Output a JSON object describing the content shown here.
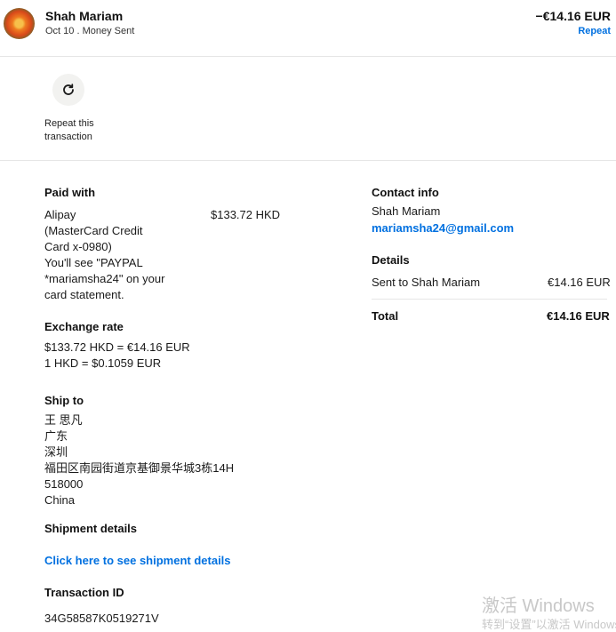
{
  "header": {
    "name": "Shah Mariam",
    "subline": "Oct 10 . Money Sent",
    "amount": "−€14.16 EUR",
    "repeat_label": "Repeat"
  },
  "repeat_action": {
    "label_line1": "Repeat this",
    "label_line2": "transaction"
  },
  "paid_with": {
    "title": "Paid with",
    "lines": [
      "Alipay",
      "(MasterCard Credit",
      "Card x-0980)",
      "You'll see \"PAYPAL",
      "*mariamsha24\" on your",
      "card statement."
    ],
    "amount": "$133.72 HKD"
  },
  "exchange_rate": {
    "title": "Exchange rate",
    "line1": "$133.72 HKD = €14.16 EUR",
    "line2": "1 HKD = $0.1059 EUR"
  },
  "ship_to": {
    "title": "Ship to",
    "lines": [
      "王 思凡",
      "广东",
      "深圳",
      "福田区南园街道京基御景华城3栋14H",
      "518000",
      "China"
    ]
  },
  "shipment_details": {
    "title": "Shipment details",
    "link": "Click here to see shipment details"
  },
  "transaction_id": {
    "title": "Transaction ID",
    "value": "34G58587K0519271V"
  },
  "contact_info": {
    "title": "Contact info",
    "name": "Shah Mariam",
    "email": "mariamsha24@gmail.com"
  },
  "details": {
    "title": "Details",
    "row_label": "Sent to Shah Mariam",
    "row_amount": "€14.16 EUR",
    "total_label": "Total",
    "total_amount": "€14.16 EUR"
  },
  "watermark": {
    "line1": "激活 Windows",
    "line2": "转到“设置”以激活 Windows。"
  },
  "colors": {
    "accent": "#0070e0",
    "divider": "#e6e6e6"
  }
}
